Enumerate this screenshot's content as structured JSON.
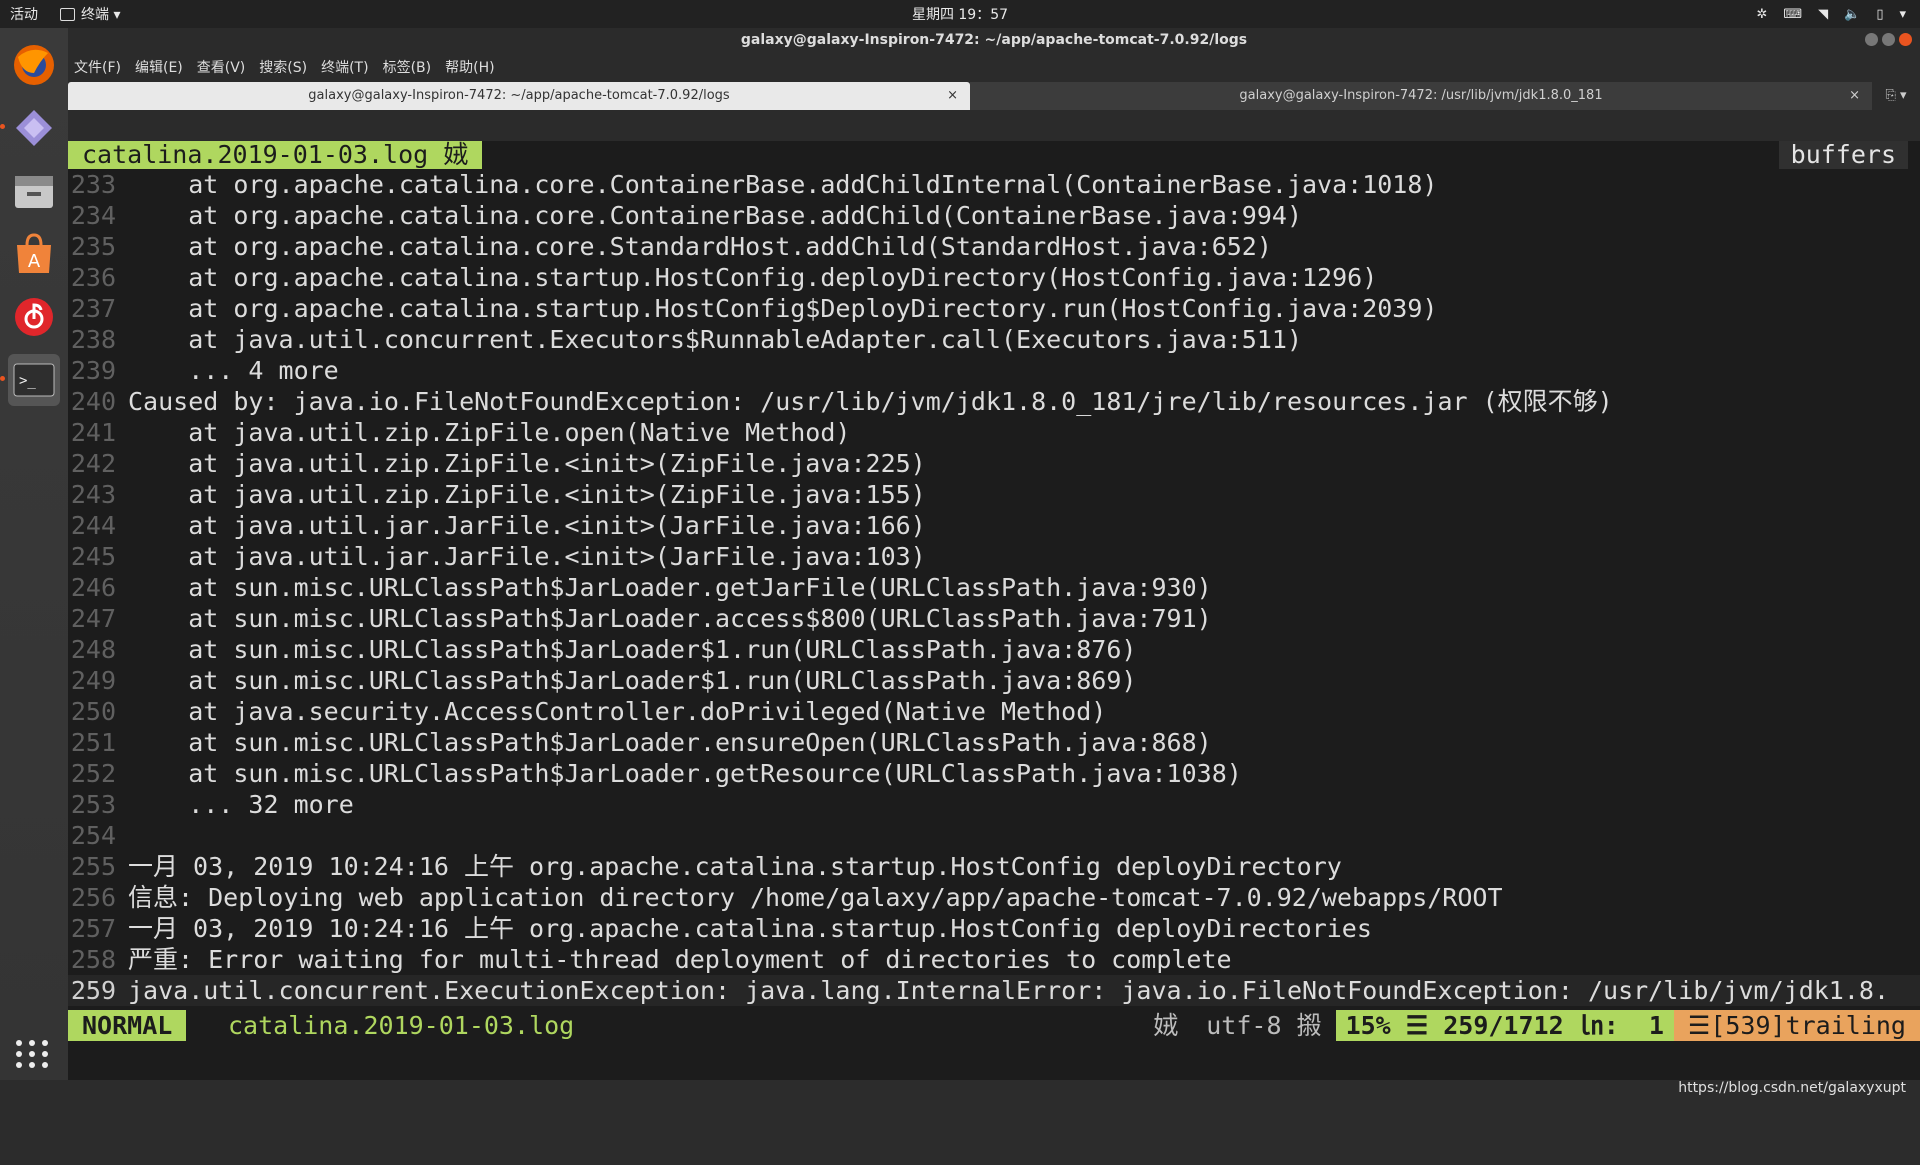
{
  "topbar": {
    "activities": "活动",
    "app": "终端 ▾",
    "clock": "星期四 19：57"
  },
  "window": {
    "title": "galaxy@galaxy-Inspiron-7472: ~/app/apache-tomcat-7.0.92/logs",
    "menu": [
      "文件(F)",
      "编辑(E)",
      "查看(V)",
      "搜索(S)",
      "终端(T)",
      "标签(B)",
      "帮助(H)"
    ],
    "tabs": [
      {
        "label": "galaxy@galaxy-Inspiron-7472: ~/app/apache-tomcat-7.0.92/logs",
        "close": "×"
      },
      {
        "label": "galaxy@galaxy-Inspiron-7472: /usr/lib/jvm/jdk1.8.0_181",
        "close": "×"
      }
    ]
  },
  "vim": {
    "tabline_buffer": "catalina.2019-01-03.log 娀",
    "tabline_right": "buffers",
    "lines": [
      {
        "n": "233",
        "text": "    at org.apache.catalina.core.ContainerBase.addChildInternal(ContainerBase.java:1018)"
      },
      {
        "n": "234",
        "text": "    at org.apache.catalina.core.ContainerBase.addChild(ContainerBase.java:994)"
      },
      {
        "n": "235",
        "text": "    at org.apache.catalina.core.StandardHost.addChild(StandardHost.java:652)"
      },
      {
        "n": "236",
        "text": "    at org.apache.catalina.startup.HostConfig.deployDirectory(HostConfig.java:1296)"
      },
      {
        "n": "237",
        "text": "    at org.apache.catalina.startup.HostConfig$DeployDirectory.run(HostConfig.java:2039)"
      },
      {
        "n": "238",
        "text": "    at java.util.concurrent.Executors$RunnableAdapter.call(Executors.java:511)"
      },
      {
        "n": "239",
        "text": "    ... 4 more"
      },
      {
        "n": "240",
        "text": "Caused by: java.io.FileNotFoundException: /usr/lib/jvm/jdk1.8.0_181/jre/lib/resources.jar (权限不够)"
      },
      {
        "n": "241",
        "text": "    at java.util.zip.ZipFile.open(Native Method)"
      },
      {
        "n": "242",
        "text": "    at java.util.zip.ZipFile.<init>(ZipFile.java:225)"
      },
      {
        "n": "243",
        "text": "    at java.util.zip.ZipFile.<init>(ZipFile.java:155)"
      },
      {
        "n": "244",
        "text": "    at java.util.jar.JarFile.<init>(JarFile.java:166)"
      },
      {
        "n": "245",
        "text": "    at java.util.jar.JarFile.<init>(JarFile.java:103)"
      },
      {
        "n": "246",
        "text": "    at sun.misc.URLClassPath$JarLoader.getJarFile(URLClassPath.java:930)"
      },
      {
        "n": "247",
        "text": "    at sun.misc.URLClassPath$JarLoader.access$800(URLClassPath.java:791)"
      },
      {
        "n": "248",
        "text": "    at sun.misc.URLClassPath$JarLoader$1.run(URLClassPath.java:876)"
      },
      {
        "n": "249",
        "text": "    at sun.misc.URLClassPath$JarLoader$1.run(URLClassPath.java:869)"
      },
      {
        "n": "250",
        "text": "    at java.security.AccessController.doPrivileged(Native Method)"
      },
      {
        "n": "251",
        "text": "    at sun.misc.URLClassPath$JarLoader.ensureOpen(URLClassPath.java:868)"
      },
      {
        "n": "252",
        "text": "    at sun.misc.URLClassPath$JarLoader.getResource(URLClassPath.java:1038)"
      },
      {
        "n": "253",
        "text": "    ... 32 more"
      },
      {
        "n": "254",
        "text": ""
      },
      {
        "n": "255",
        "text": "一月 03, 2019 10:24:16 上午 org.apache.catalina.startup.HostConfig deployDirectory"
      },
      {
        "n": "256",
        "text": "信息: Deploying web application directory /home/galaxy/app/apache-tomcat-7.0.92/webapps/ROOT"
      },
      {
        "n": "257",
        "text": "一月 03, 2019 10:24:16 上午 org.apache.catalina.startup.HostConfig deployDirectories"
      },
      {
        "n": "258",
        "text": "严重: Error waiting for multi-thread deployment of directories to complete"
      },
      {
        "n": "259",
        "text": "java.util.concurrent.ExecutionException: java.lang.InternalError: java.io.FileNotFoundException: /usr/lib/jvm/jdk1.8."
      }
    ],
    "status": {
      "mode": "NORMAL",
      "file": "catalina.2019-01-03.log",
      "filetype_icon": "娀",
      "encoding": "utf-8 摋",
      "position": "15% ☰ 259/1712 ㏑:  1",
      "trailing": "☰[539]trailing"
    }
  },
  "watermark": "https://blog.csdn.net/galaxyxupt"
}
